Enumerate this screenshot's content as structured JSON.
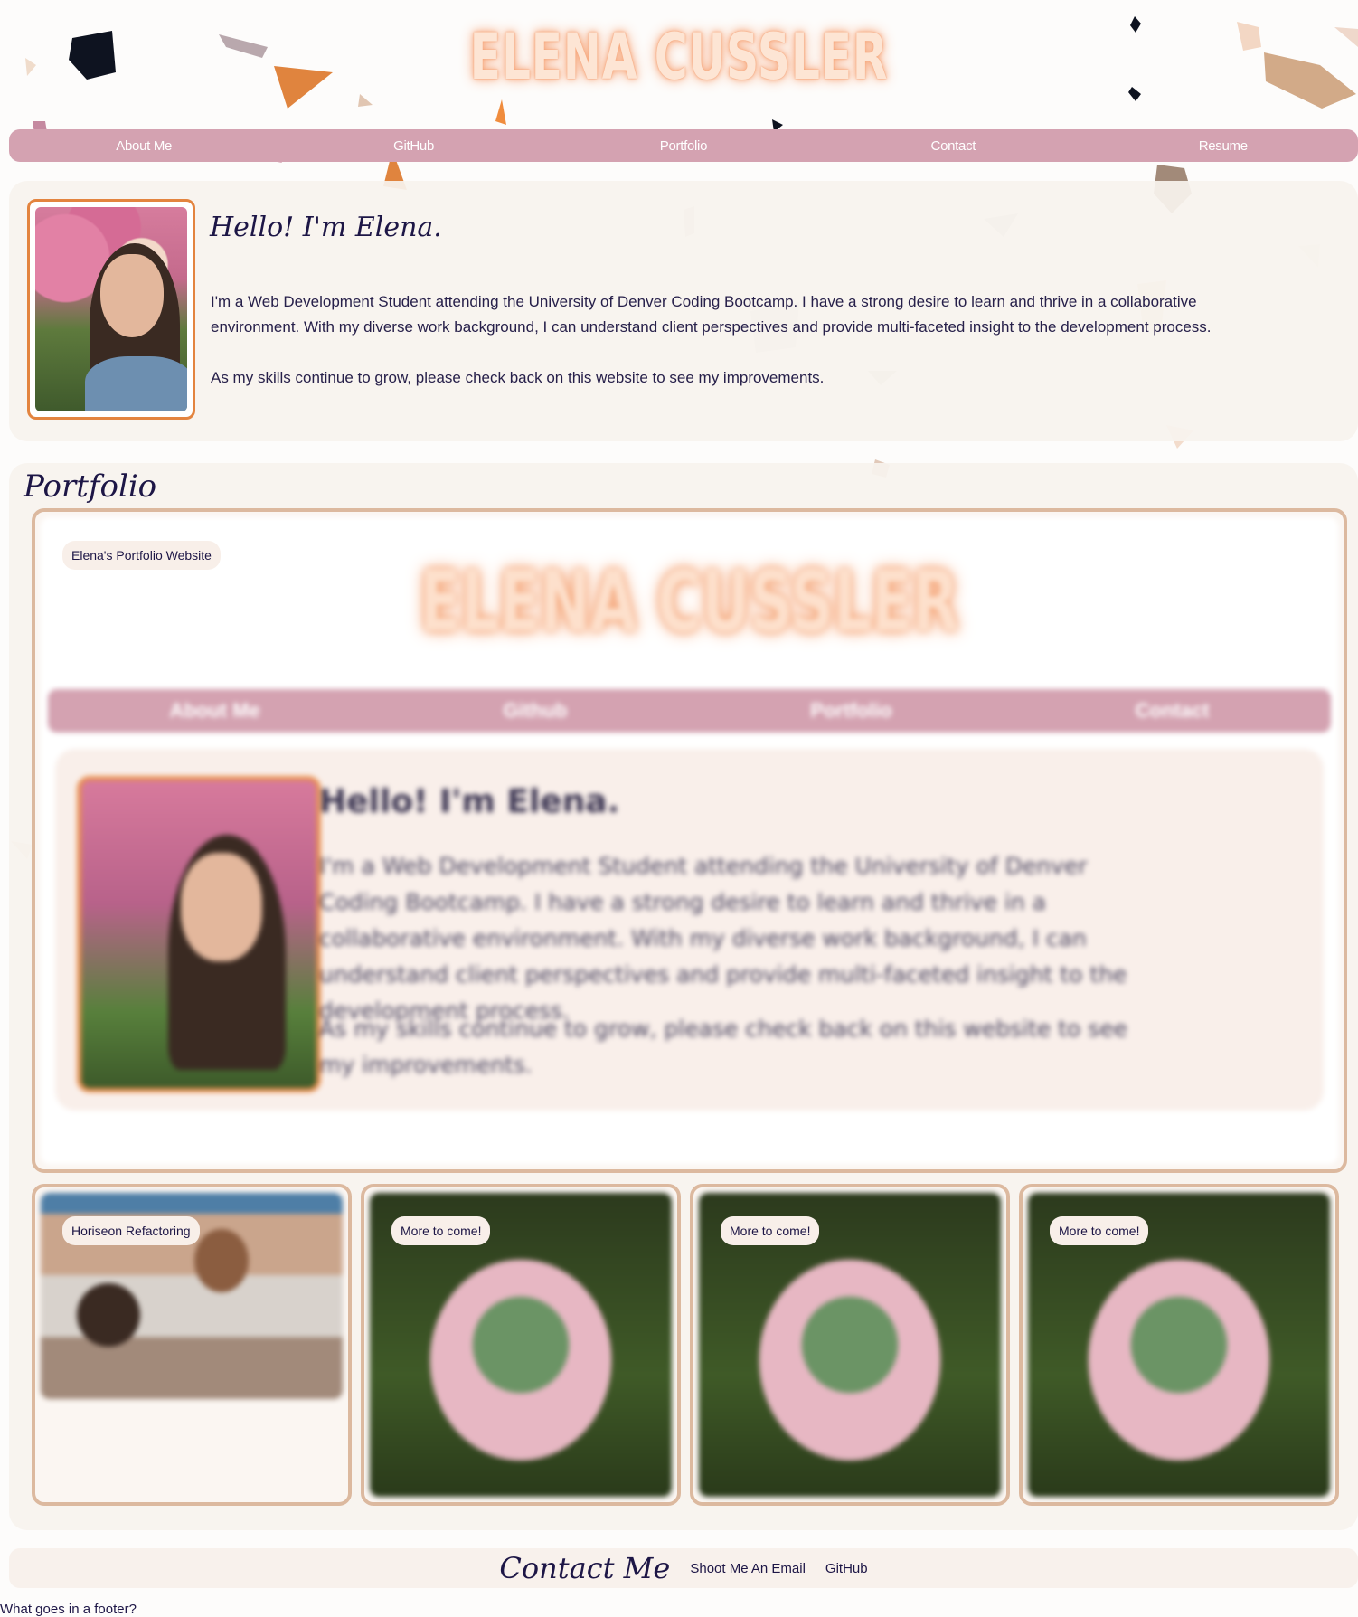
{
  "header": {
    "title": "ELENA CUSSLER"
  },
  "nav": {
    "items": [
      "About Me",
      "GitHub",
      "Portfolio",
      "Contact",
      "Resume"
    ]
  },
  "about": {
    "heading": "Hello! I'm Elena.",
    "paragraph1": "I'm a Web Development Student attending the University of Denver Coding Bootcamp. I have a strong desire to learn and thrive in a collaborative environment. With my diverse work background, I can understand client perspectives and provide multi-faceted insight to the development process.",
    "paragraph2": "As my skills continue to grow, please check back on this website to see my improvements."
  },
  "portfolio": {
    "heading": "Portfolio",
    "main_card": {
      "label": "Elena's Portfolio Website",
      "preview": {
        "title": "ELENA CUSSLER",
        "nav": [
          "About Me",
          "Github",
          "Portfolio",
          "Contact"
        ],
        "heading": "Hello! I'm Elena.",
        "paragraph1": "I'm a Web Development Student attending the University of Denver Coding Bootcamp. I have a strong desire to learn and thrive in a collaborative environment. With my diverse work background, I can understand client perspectives and provide multi-faceted insight to the development process.",
        "paragraph2": "As my skills continue to grow, please check back on this website to see my improvements."
      }
    },
    "cards": [
      {
        "label": "Horiseon Refactoring"
      },
      {
        "label": "More to come!"
      },
      {
        "label": "More to come!"
      },
      {
        "label": "More to come!"
      }
    ]
  },
  "footer": {
    "heading": "Contact Me",
    "links": [
      "Shoot Me An Email",
      "GitHub"
    ],
    "note": "What goes in a footer?"
  },
  "colors": {
    "nav_bg": "#d4a2b1",
    "title_glow": "#f7a679",
    "photo_border": "#e3843f",
    "card_border": "#dcb99f",
    "text": "#1d1646"
  }
}
